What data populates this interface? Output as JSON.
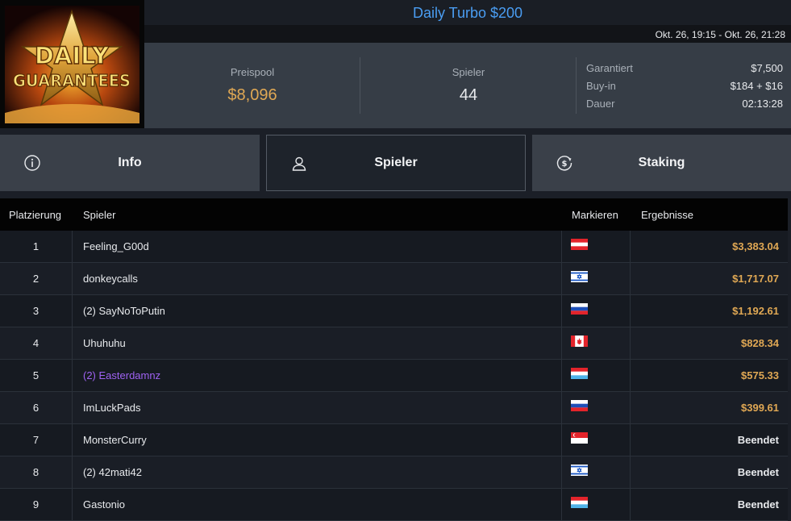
{
  "logo": {
    "line1": "DAILY",
    "line2": "GUARANTEES"
  },
  "tournament": {
    "title": "Daily Turbo $200",
    "dates": "Okt. 26, 19:15 - Okt. 26, 21:28"
  },
  "stats": {
    "pool_label": "Preispool",
    "pool_value": "$8,096",
    "players_label": "Spieler",
    "players_value": "44",
    "details": [
      {
        "label": "Garantiert",
        "value": "$7,500"
      },
      {
        "label": "Buy-in",
        "value": "$184 + $16"
      },
      {
        "label": "Dauer",
        "value": "02:13:28"
      }
    ]
  },
  "tabs": {
    "info": "Info",
    "players": "Spieler",
    "staking": "Staking",
    "active": "players"
  },
  "table": {
    "headers": {
      "rank": "Platzierung",
      "player": "Spieler",
      "flag": "Markieren",
      "result": "Ergebnisse"
    },
    "rows": [
      {
        "rank": "1",
        "name": "Feeling_G00d",
        "flag": "austria",
        "result": "$3,383.04",
        "paid": true,
        "highlight": false
      },
      {
        "rank": "2",
        "name": "donkeycalls",
        "flag": "israel",
        "result": "$1,717.07",
        "paid": true,
        "highlight": false
      },
      {
        "rank": "3",
        "name": "(2) SayNoToPutin",
        "flag": "russia",
        "result": "$1,192.61",
        "paid": true,
        "highlight": false
      },
      {
        "rank": "4",
        "name": "Uhuhuhu",
        "flag": "canada",
        "result": "$828.34",
        "paid": true,
        "highlight": false
      },
      {
        "rank": "5",
        "name": "(2) Easterdamnz",
        "flag": "luxembourg",
        "result": "$575.33",
        "paid": true,
        "highlight": true
      },
      {
        "rank": "6",
        "name": "ImLuckPads",
        "flag": "russia",
        "result": "$399.61",
        "paid": true,
        "highlight": false
      },
      {
        "rank": "7",
        "name": "MonsterCurry",
        "flag": "singapore",
        "result": "Beendet",
        "paid": false,
        "highlight": false
      },
      {
        "rank": "8",
        "name": "(2) 42mati42",
        "flag": "israel",
        "result": "Beendet",
        "paid": false,
        "highlight": false
      },
      {
        "rank": "9",
        "name": "Gastonio",
        "flag": "luxembourg",
        "result": "Beendet",
        "paid": false,
        "highlight": false
      }
    ]
  },
  "colors": {
    "title": "#4a9df2",
    "money": "#e0a854",
    "highlight_player": "#9f62f2",
    "stats_bg": "#363d46",
    "tab_bg": "#3a4049",
    "active_tab_bg": "#1e232b"
  }
}
